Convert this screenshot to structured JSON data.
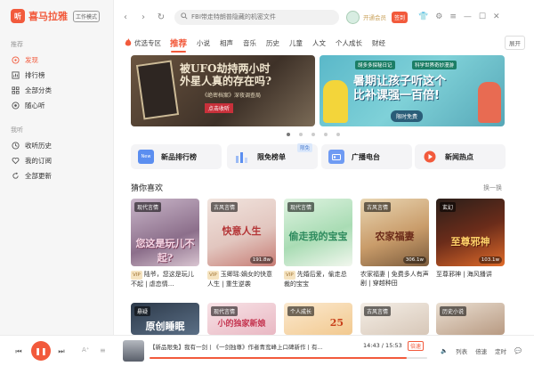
{
  "app": {
    "name": "喜马拉雅",
    "mode_badge": "工作模式",
    "logo_glyph": "听"
  },
  "sidebar": {
    "section1": "推荐",
    "items1": [
      {
        "label": "发现",
        "icon": "compass-icon",
        "active": true
      },
      {
        "label": "排行榜",
        "icon": "chart-icon"
      },
      {
        "label": "全部分类",
        "icon": "grid-icon"
      },
      {
        "label": "随心听",
        "icon": "radio-icon"
      }
    ],
    "section2": "我听",
    "items2": [
      {
        "label": "收听历史",
        "icon": "clock-icon"
      },
      {
        "label": "我的订阅",
        "icon": "heart-icon"
      },
      {
        "label": "全部更新",
        "icon": "refresh-icon"
      }
    ]
  },
  "topbar": {
    "search_placeholder": "FBI带走特朗普隐藏的机密文件",
    "vip_text": "开通会员",
    "badge": "签到"
  },
  "tabs": {
    "featured": "优选专区",
    "items": [
      "推荐",
      "小说",
      "相声",
      "音乐",
      "历史",
      "儿童",
      "人文",
      "个人成长",
      "财经"
    ],
    "active_index": 0,
    "expand": "展开"
  },
  "banners": {
    "b1": {
      "title_line1": "被UFO劫持两小时",
      "title_line2": "外星人真的存在吗?",
      "sub": "《绝密档案》深夜调查局",
      "stamp": "点击收听"
    },
    "b2": {
      "tag1": "胡多多探秘日记",
      "tag2": "科学世界奇妙漫游",
      "title_line1": "暑期让孩子听这个",
      "title_line2": "比补课强一百倍!",
      "button": "限时免费"
    }
  },
  "quick": [
    {
      "label": "新品排行榜",
      "icon": "new-icon",
      "color": "#5b8ef0",
      "icon_text": "New"
    },
    {
      "label": "限免榜单",
      "icon": "bars-icon",
      "color": "#8fb2f5",
      "badge": "限免"
    },
    {
      "label": "广播电台",
      "icon": "radio-station-icon",
      "color": "#6f9bf3"
    },
    {
      "label": "新闻热点",
      "icon": "play-circle-icon",
      "color": "#f25a3c"
    }
  ],
  "section": {
    "title": "猜你喜欢",
    "more": "换一换"
  },
  "books": [
    {
      "genre": "现代言情",
      "cover_title": "您这是玩儿不起?",
      "plays": "",
      "vip": "VIP",
      "desc": "陆爷，您这是玩儿不起 | 虐恋情..."
    },
    {
      "genre": "古风言情",
      "cover_title": "快意人生",
      "plays": "191.8w",
      "vip": "VIP",
      "desc": "玉卿瑶:嫡女的快意人生 | 重生逆袭"
    },
    {
      "genre": "现代言情",
      "cover_title": "偷走我的宝宝",
      "plays": "",
      "vip": "VIP",
      "desc": "先婚后爱，偷走总裁的宝宝"
    },
    {
      "genre": "古风言情",
      "cover_title": "农家福妻",
      "plays": "306.1w",
      "vip": "",
      "desc": "农家福妻 | 免费多人有声剧 | 穿越种田"
    },
    {
      "genre": "玄幻",
      "cover_title": "至尊邪神",
      "plays": "103.1w",
      "vip": "",
      "desc": "至尊邪神 | 海风播讲"
    }
  ],
  "books_row2": [
    {
      "genre": "悬疑",
      "cover_title": "原创睡眠"
    },
    {
      "genre": "现代言情",
      "cover_title": "小的独家新娘"
    },
    {
      "genre": "个人成长",
      "cover_title": "25"
    },
    {
      "genre": "古风言情",
      "cover_title": ""
    },
    {
      "genre": "历史小说",
      "cover_title": ""
    }
  ],
  "player": {
    "track": "【新品限免】我有一剑丨《一剑独尊》作者青鸾峰上口碑新作丨有...",
    "time": "14:43 / 15:53",
    "speed": "倍速",
    "progress": 0.926,
    "right": [
      "音量",
      "列表",
      "倍速",
      "定时",
      "评论"
    ]
  }
}
